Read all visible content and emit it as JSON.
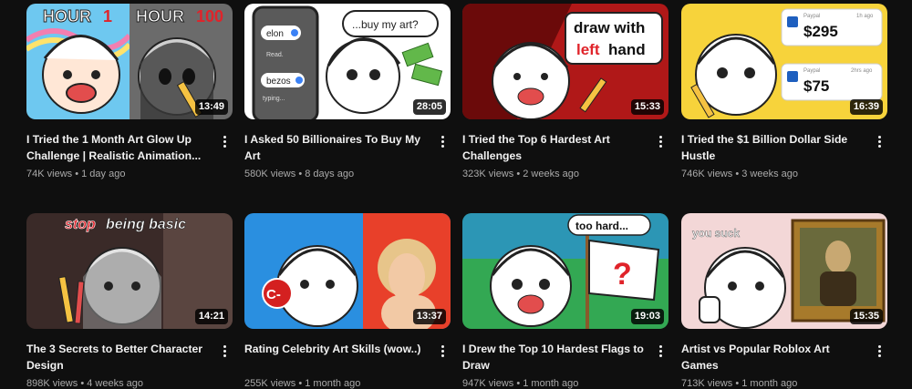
{
  "videos": [
    {
      "title": "I Tried the 1 Month Art Glow Up Challenge | Realistic Animation...",
      "views": "74K views",
      "age": "1 day ago",
      "duration": "13:49",
      "thumb": {
        "left": "HOUR",
        "left_num": "1",
        "right": "HOUR",
        "right_num": "100"
      }
    },
    {
      "title": "I Asked 50 Billionaires To Buy My Art",
      "views": "580K views",
      "age": "8 days ago",
      "duration": "28:05",
      "thumb": {
        "bubble": "...buy my art?",
        "chat1": "elon",
        "chat2": "Read.",
        "chat3": "bezos",
        "chat4": "typing..."
      }
    },
    {
      "title": "I Tried the Top 6 Hardest Art Challenges",
      "views": "323K views",
      "age": "2 weeks ago",
      "duration": "15:33",
      "thumb": {
        "line1": "draw with",
        "line2a": "left",
        "line2b": "hand"
      }
    },
    {
      "title": "I Tried the $1 Billion Dollar Side Hustle",
      "views": "746K views",
      "age": "3 weeks ago",
      "duration": "16:39",
      "thumb": {
        "pay1_label": "Paypal",
        "pay1_time": "1h ago",
        "pay1_amount": "$295",
        "pay2_label": "Paypal",
        "pay2_time": "2hrs ago",
        "pay2_amount": "$75"
      }
    },
    {
      "title": "The 3 Secrets to Better Character Design",
      "views": "898K views",
      "age": "4 weeks ago",
      "duration": "14:21",
      "thumb": {
        "word1": "stop",
        "word2": "being basic"
      }
    },
    {
      "title": "Rating Celebrity Art Skills (wow..)",
      "views": "255K views",
      "age": "1 month ago",
      "duration": "13:37",
      "thumb": {
        "grade": "C-"
      }
    },
    {
      "title": "I Drew the Top 10 Hardest Flags to Draw",
      "views": "947K views",
      "age": "1 month ago",
      "duration": "19:03",
      "thumb": {
        "bubble": "too hard...",
        "flag": "?"
      }
    },
    {
      "title": "Artist vs Popular Roblox Art Games",
      "views": "713K views",
      "age": "1 month ago",
      "duration": "15:35",
      "thumb": {
        "caption": "you suck"
      }
    }
  ],
  "meta_separator": "•",
  "icons": {
    "more": "more-vert-icon"
  }
}
